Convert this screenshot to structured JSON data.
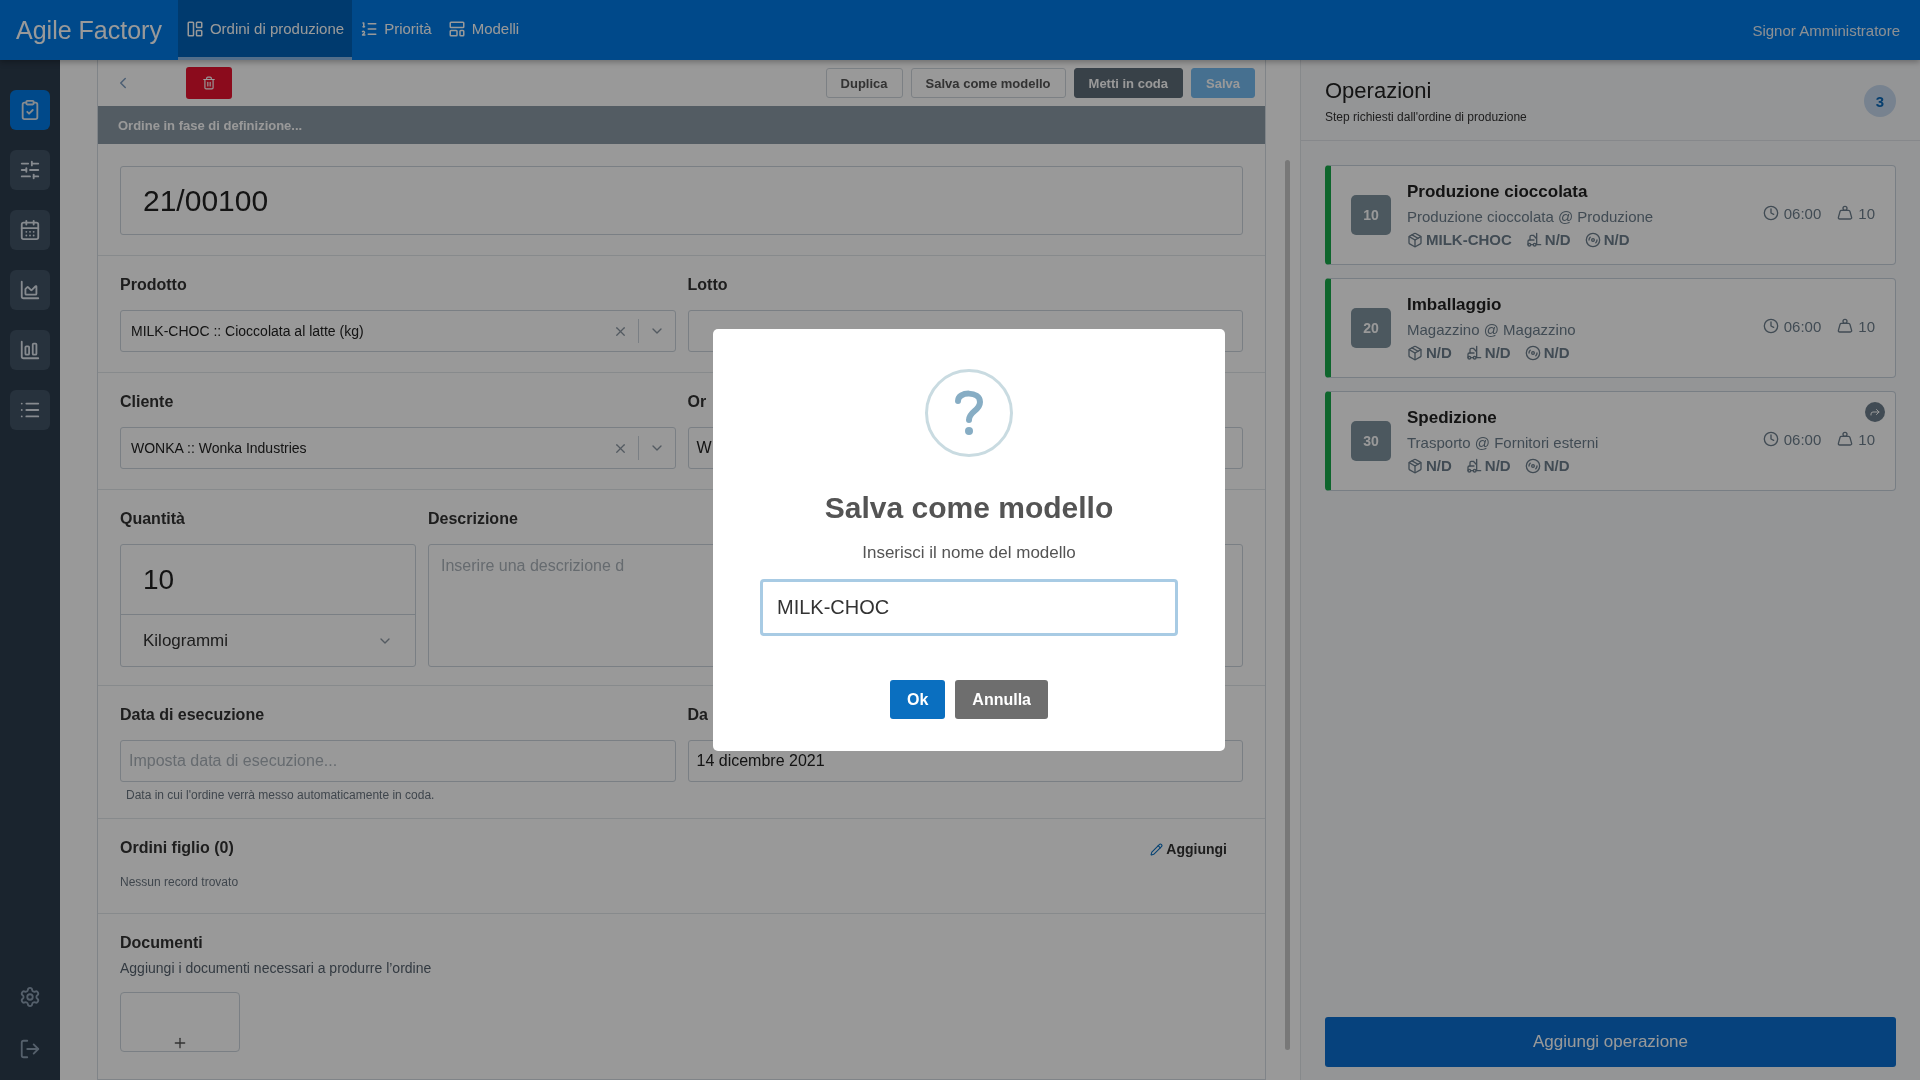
{
  "topbar": {
    "brand": "Agile Factory",
    "nav": [
      {
        "label": "Ordini di produzione",
        "kind": "board",
        "selected": true
      },
      {
        "label": "Priorità",
        "kind": "priority",
        "selected": false
      },
      {
        "label": "Modelli",
        "kind": "template",
        "selected": false
      }
    ],
    "user": "Signor Amministratore"
  },
  "sidebar": {
    "items": [
      {
        "kind": "orders",
        "selected": true
      },
      {
        "kind": "planning",
        "selected": false
      },
      {
        "kind": "calendar",
        "selected": false
      },
      {
        "kind": "area",
        "selected": false
      },
      {
        "kind": "bars",
        "selected": false
      },
      {
        "kind": "list",
        "selected": false
      }
    ],
    "bottom": [
      {
        "kind": "settings"
      },
      {
        "kind": "logout"
      }
    ]
  },
  "toolbar": {
    "buttons": [
      {
        "label": "Duplica",
        "kind": "outline",
        "disabled": false
      },
      {
        "label": "Salva come modello",
        "kind": "outline",
        "disabled": false
      },
      {
        "label": "Metti in coda",
        "kind": "dark",
        "disabled": false
      },
      {
        "label": "Salva",
        "kind": "primary",
        "disabled": true
      }
    ]
  },
  "status_banner": "Ordine in fase di definizione...",
  "order_number": "21/00100",
  "fields": {
    "product": {
      "label": "Prodotto",
      "value": "MILK-CHOC :: Cioccolata al latte (kg)"
    },
    "lot": {
      "label": "Lotto"
    },
    "customer": {
      "label": "Cliente",
      "value": "WONKA :: Wonka Industries"
    },
    "field_4": {
      "label": "Or",
      "value": "W"
    },
    "quantity": {
      "label": "Quantità",
      "value": "10",
      "unit": "Kilogrammi"
    },
    "description": {
      "label": "Descrizione",
      "placeholder": "Inserire una descrizione d"
    },
    "execution_date": {
      "label": "Data di esecuzione",
      "placeholder": "Imposta data di esecuzione...",
      "hint": "Data in cui l'ordine verrà messo automaticamente in coda."
    },
    "field_8": {
      "label": "Da",
      "value": "14 dicembre 2021"
    }
  },
  "child_orders": {
    "title": "Ordini figlio (0)",
    "action": "Aggiungi",
    "empty": "Nessun record trovato"
  },
  "documents": {
    "title": "Documenti",
    "subtitle": "Aggiungi i documenti necessari a produrre l’ordine"
  },
  "operations": {
    "title": "Operazioni",
    "subtitle": "Step richiesti dall'ordine di produzione",
    "count": "3",
    "items": [
      {
        "step": "10",
        "name": "Produzione cioccolata",
        "location": "Produzione cioccolata @ Produzione",
        "time": "06:00",
        "quantity": "10",
        "product": "MILK-CHOC",
        "machine": "N/D",
        "tool": "N/D",
        "forwarded": false
      },
      {
        "step": "20",
        "name": "Imballaggio",
        "location": "Magazzino @ Magazzino",
        "time": "06:00",
        "quantity": "10",
        "product": "N/D",
        "machine": "N/D",
        "tool": "N/D",
        "forwarded": false
      },
      {
        "step": "30",
        "name": "Spedizione",
        "location": "Trasporto @ Fornitori esterni",
        "time": "06:00",
        "quantity": "10",
        "product": "N/D",
        "machine": "N/D",
        "tool": "N/D",
        "forwarded": true
      }
    ],
    "add_button": "Aggiungi operazione"
  },
  "modal": {
    "title": "Salva come modello",
    "message": "Inserisci il nome del modello",
    "value": "MILK-CHOC",
    "buttons": [
      {
        "label": "Ok",
        "kind": "primary"
      },
      {
        "label": "Annulla",
        "kind": "secondary"
      }
    ]
  }
}
